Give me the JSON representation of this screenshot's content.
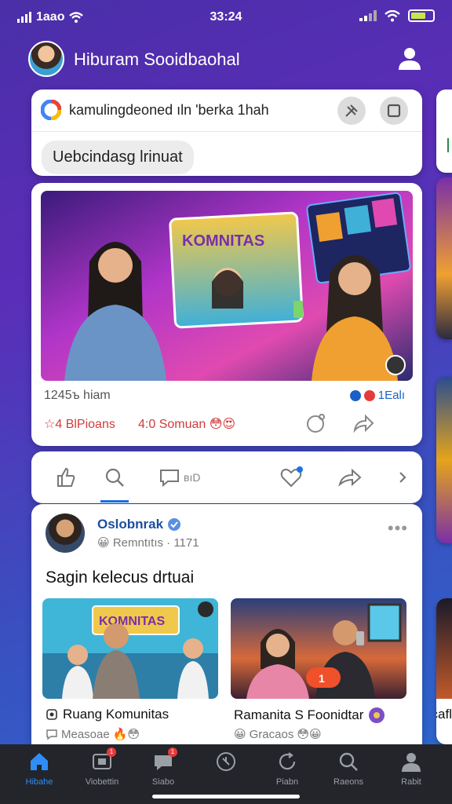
{
  "status_bar": {
    "carrier": "1aao",
    "time": "33:24"
  },
  "header": {
    "title": "Hiburam Sooidbaohal"
  },
  "search": {
    "query": "kamulingdeoned ıln 'berka 1hah",
    "chip": "Uebcindasg lrinuat"
  },
  "post": {
    "hero_sign": "KOMNITAS",
    "meta_left": "1245ъ hiam",
    "meta_right_count": "1Ealı",
    "reactions": "☆4 BlPioans",
    "comments": "4:0 Somuan",
    "colors": {
      "reaction_red": "#d23b3b",
      "link_blue": "#1a5fc9"
    }
  },
  "action_bar": {
    "comment_label": "вıD"
  },
  "feed": {
    "author": "Oslobnrak",
    "author_sub": "Remntıtıs · 1171",
    "headline": "Sagin kelecus drtuai",
    "tiles": [
      {
        "title": "Ruang Komunitas",
        "sub": "Measoae",
        "sign": "KOMNITAS"
      },
      {
        "title": "Ramanita S Foonidtar",
        "sub": "Gracaos",
        "sign": "1"
      }
    ],
    "peek_title": "Hcafl"
  },
  "bottom_nav": [
    {
      "label": "Hibahe",
      "icon": "home-icon",
      "active": true
    },
    {
      "label": "Viobettin",
      "icon": "video-icon",
      "badge": "1"
    },
    {
      "label": "Siabo",
      "icon": "chat-icon",
      "badge": "1"
    },
    {
      "label": "",
      "icon": "mic-icon"
    },
    {
      "label": "Piabn",
      "icon": "refresh-icon"
    },
    {
      "label": "Raeons",
      "icon": "search-icon"
    },
    {
      "label": "Rabit",
      "icon": "profile-icon"
    }
  ]
}
